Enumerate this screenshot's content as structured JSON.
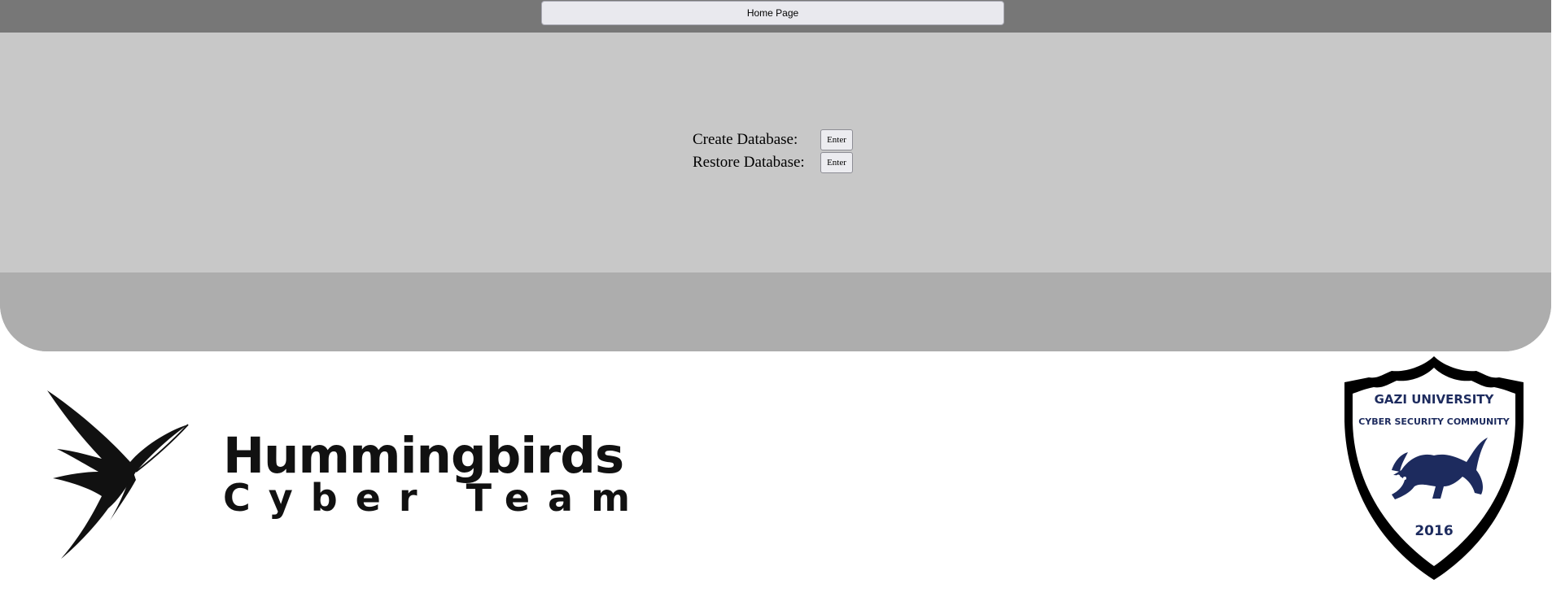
{
  "header": {
    "home_label": "Home Page"
  },
  "database": {
    "create_label": "Create Database:",
    "restore_label": "Restore Database:",
    "create_button": "Enter",
    "restore_button": "Enter"
  },
  "footer": {
    "team_line1": "Hummingbirds",
    "team_line2": "Cyber Team",
    "community_name": "GAZI UNIVERSITY",
    "community_subtitle": "CYBER SECURITY COMMUNITY",
    "community_year": "2016"
  },
  "colors": {
    "top_bar": "#777777",
    "content_panel": "#c8c8c8",
    "bottom_strip": "#adadad",
    "badge_navy": "#1d2b5e"
  },
  "icons": [
    "hummingbird-icon",
    "wolf-icon",
    "shield-icon"
  ]
}
